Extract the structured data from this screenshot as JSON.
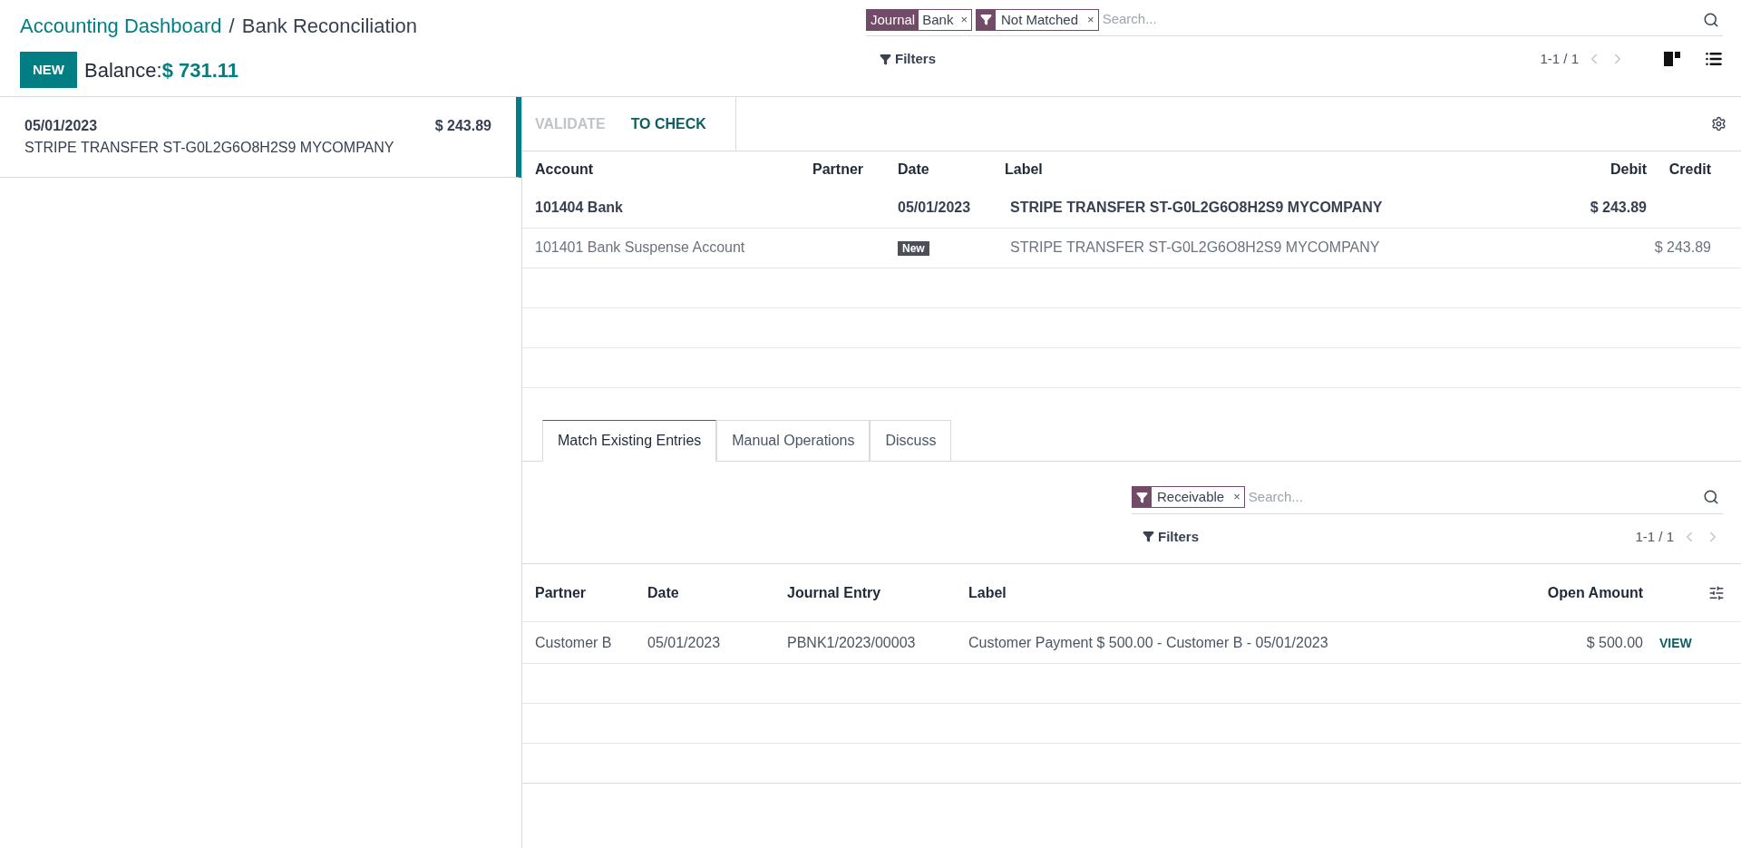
{
  "breadcrumbs": [
    {
      "kind": "link",
      "label": "Accounting Dashboard"
    },
    {
      "kind": "current",
      "label": "Bank Reconciliation"
    }
  ],
  "breadcrumb_separator": "/",
  "new_button": "NEW",
  "balance": {
    "label": "Balance:",
    "amount": "$ 731.11"
  },
  "search": {
    "facets": [
      {
        "kind": "group",
        "name": "Journal",
        "value": "Bank",
        "remove": "×"
      },
      {
        "kind": "filter",
        "value": "Not Matched",
        "remove": "×"
      }
    ],
    "placeholder": "Search...",
    "filters": "Filters",
    "pager": "1-1 / 1"
  },
  "statements": [
    {
      "date": "05/01/2023",
      "amount": "$ 243.89",
      "label": "STRIPE TRANSFER ST-G0L2G6O8H2S9 MYCOMPANY",
      "selected": true
    }
  ],
  "actions": [
    {
      "label": "VALIDATE",
      "disabled": true
    },
    {
      "label": "TO CHECK",
      "disabled": false
    }
  ],
  "lines_table": {
    "columns": [
      "Account",
      "Partner",
      "Date",
      "Label",
      "Debit",
      "Credit"
    ],
    "rows": [
      {
        "kind": "liquidity",
        "account": "101404 Bank",
        "date": "05/01/2023",
        "label": "STRIPE TRANSFER ST-G0L2G6O8H2S9 MYCOMPANY",
        "debit": "$ 243.89"
      },
      {
        "kind": "suspense",
        "account": "101401 Bank Suspense Account",
        "badge": "New",
        "label": "STRIPE TRANSFER ST-G0L2G6O8H2S9 MYCOMPANY",
        "credit": "$ 243.89"
      }
    ]
  },
  "tabs": [
    {
      "label": "Match Existing Entries",
      "selected": true
    },
    {
      "label": "Manual Operations",
      "selected": false
    },
    {
      "label": "Discuss",
      "selected": false
    }
  ],
  "match": {
    "facets": [
      {
        "kind": "filter",
        "value": "Receivable",
        "remove": "×"
      }
    ],
    "placeholder": "Search...",
    "filters": "Filters",
    "pager": "1-1 / 1",
    "columns": [
      "Partner",
      "Date",
      "Journal Entry",
      "Label",
      "Open Amount"
    ],
    "rows": [
      {
        "partner": "Customer B",
        "date": "05/01/2023",
        "journal_entry": "PBNK1/2023/00003",
        "label": "Customer Payment $ 500.00 - Customer B - 05/01/2023",
        "open_amount": "$ 500.00",
        "action": "VIEW"
      }
    ]
  }
}
